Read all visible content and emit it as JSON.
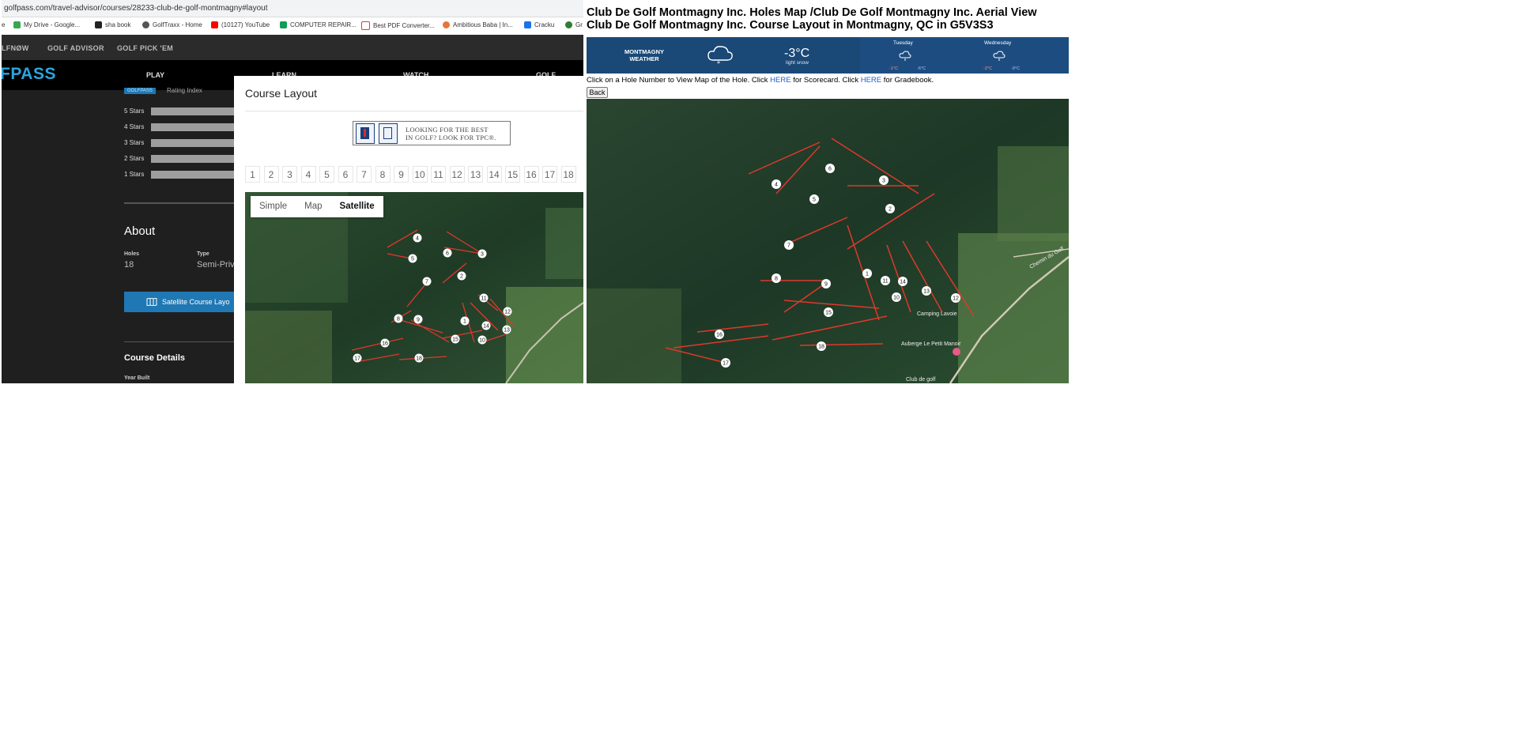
{
  "left": {
    "address_bar": "golfpass.com/travel-advisor/courses/28233-club-de-golf-montmagny#layout",
    "bookmarks": [
      "My Drive - Google...",
      "sha book",
      "GolfTraxx - Home",
      "(10127) YouTube",
      "COMPUTER REPAIR...",
      "Best PDF Converter...",
      "Ambitious Baba | In...",
      "Cracku",
      "Gr"
    ],
    "bookmark_lead": "e",
    "top_nav": [
      "LFNØW",
      "GOLF ADVISOR",
      "GOLF PICK 'EM"
    ],
    "logo": "FPASS",
    "main_nav": [
      "PLAY",
      "LEARN",
      "WATCH",
      "GOLF ADVISO"
    ],
    "rating_tag": "GOLFPASS",
    "rating_index": "Rating Index",
    "stars": [
      "5 Stars",
      "4 Stars",
      "3 Stars",
      "2 Stars",
      "1 Stars"
    ],
    "about": {
      "heading": "About",
      "holes_label": "Holes",
      "holes_value": "18",
      "type_label": "Type",
      "type_value": "Semi-Priva"
    },
    "satellite_button": "Satellite Course Layo",
    "course_details": "Course Details",
    "year_built": "Year Built",
    "modal": {
      "title": "Course Layout",
      "ad_text_line1": "LOOKING FOR THE BEST",
      "ad_text_line2": "IN GOLF? LOOK FOR TPC®.",
      "holes": [
        "1",
        "2",
        "3",
        "4",
        "5",
        "6",
        "7",
        "8",
        "9",
        "10",
        "11",
        "12",
        "13",
        "14",
        "15",
        "16",
        "17",
        "18"
      ],
      "map_tabs": [
        "Simple",
        "Map",
        "Satellite"
      ],
      "active_tab": "Satellite",
      "map_hole_labels": [
        "4",
        "5",
        "6",
        "3",
        "2",
        "7",
        "11",
        "12",
        "8",
        "9",
        "1",
        "14",
        "13",
        "15",
        "10",
        "16",
        "17",
        "18"
      ]
    }
  },
  "right": {
    "title_line1": "Club De Golf Montmagny Inc. Holes Map /Club De Golf Montmagny Inc. Aerial View",
    "title_line2": "Club De Golf Montmagny Inc. Course Layout in Montmagny, QC in G5V3S3",
    "weather": {
      "location_line1": "MONTMAGNY",
      "location_line2": "WEATHER",
      "temp": "-3°C",
      "condition": "light snow",
      "days": [
        {
          "name": "Tuesday",
          "high": "-1°C",
          "low": "-6°C"
        },
        {
          "name": "Wednesday",
          "high": "-2°C",
          "low": "-9°C"
        }
      ]
    },
    "instructions": {
      "before": "Click on a Hole Number to View Map of the Hole. Click ",
      "link1": "HERE",
      "middle": " for Scorecard. Click ",
      "link2": "HERE",
      "after": " for Gradebook."
    },
    "back_button": "Back",
    "map_hole_labels": [
      "4",
      "6",
      "3",
      "5",
      "2",
      "7",
      "8",
      "1",
      "11",
      "9",
      "10",
      "13",
      "12",
      "15",
      "16",
      "18",
      "17",
      "14"
    ],
    "map_places": [
      "Auberge Le Petit Manoir",
      "Club de golf",
      "Chemin du Golf",
      "Camping Lavoie"
    ]
  },
  "colors": {
    "golfpass_blue": "#2ba6de",
    "button_blue": "#1f78b4",
    "weather_bg": "#1d4d80",
    "link_blue": "#1a5fd4",
    "fairway_line": "#e0382b"
  }
}
